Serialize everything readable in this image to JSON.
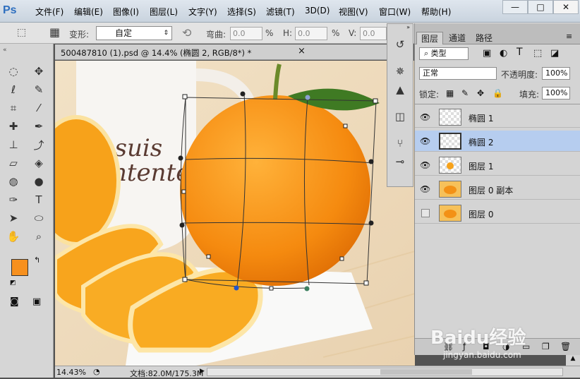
{
  "app": {
    "logo": "Ps"
  },
  "menu": [
    "文件(F)",
    "编辑(E)",
    "图像(I)",
    "图层(L)",
    "文字(Y)",
    "选择(S)",
    "滤镜(T)",
    "3D(D)",
    "视图(V)",
    "窗口(W)",
    "帮助(H)"
  ],
  "window_controls": {
    "minimize": "—",
    "maximize": "□",
    "close": "✕"
  },
  "options": {
    "transform_label": "变形:",
    "transform_value": "自定",
    "bend_label": "弯曲:",
    "bend_value": "0.0",
    "bend_unit": "%",
    "h_label": "H:",
    "h_value": "0.0",
    "h_unit": "%",
    "v_label": "V:",
    "v_value": "0.0"
  },
  "document": {
    "tab_title": "500487810 (1).psd @ 14.4% (椭圆 2, RGB/8*) *",
    "close": "×",
    "canvas_text_line1": "Je suis",
    "canvas_text_line2": "ntente"
  },
  "status": {
    "zoom": "14.43%",
    "doc": "文档:82.0M/175.3M"
  },
  "colors": {
    "foreground": "#f7901e",
    "background": "#ffffff",
    "selection": "#b6cdef",
    "accent": "#2e6fbf"
  },
  "layers_panel": {
    "tabs": [
      "图层",
      "通道",
      "路径"
    ],
    "filter_label": "类型",
    "blend_mode": "正常",
    "opacity_label": "不透明度:",
    "opacity_value": "100%",
    "lock_label": "锁定:",
    "fill_label": "填充:",
    "fill_value": "100%",
    "layers": [
      {
        "name": "椭圆 1",
        "visible": true,
        "selected": false,
        "thumb": "transparent"
      },
      {
        "name": "椭圆 2",
        "visible": true,
        "selected": true,
        "thumb": "transparent"
      },
      {
        "name": "图层 1",
        "visible": true,
        "selected": false,
        "thumb": "orange-small"
      },
      {
        "name": "图层 0 副本",
        "visible": true,
        "selected": false,
        "thumb": "orange-slices"
      },
      {
        "name": "图层 0",
        "visible": false,
        "selected": false,
        "thumb": "orange-slices"
      }
    ]
  },
  "watermark": {
    "main": "Baidu经验",
    "sub": "jingyan.baidu.com"
  }
}
